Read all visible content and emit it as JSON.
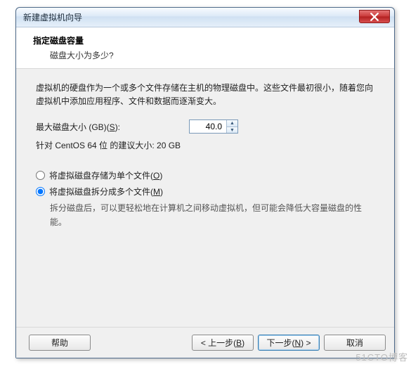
{
  "window": {
    "title": "新建虚拟机向导"
  },
  "header": {
    "title": "指定磁盘容量",
    "subtitle": "磁盘大小为多少?"
  },
  "content": {
    "description": "虚拟机的硬盘作为一个或多个文件存储在主机的物理磁盘中。这些文件最初很小，随着您向虚拟机中添加应用程序、文件和数据而逐渐变大。",
    "max_size_label_pre": "最大磁盘大小 (GB)(",
    "max_size_mnemonic": "S",
    "max_size_label_post": "):",
    "max_size_value": "40.0",
    "recommended": "针对 CentOS 64 位 的建议大小: 20 GB",
    "radio_single_pre": "将虚拟磁盘存储为单个文件(",
    "radio_single_mnemonic": "O",
    "radio_single_post": ")",
    "radio_split_pre": "将虚拟磁盘拆分成多个文件(",
    "radio_split_mnemonic": "M",
    "radio_split_post": ")",
    "radio_split_desc": "拆分磁盘后，可以更轻松地在计算机之间移动虚拟机，但可能会降低大容量磁盘的性能。"
  },
  "footer": {
    "help": "帮助",
    "back_pre": "< 上一步(",
    "back_mnemonic": "B",
    "back_post": ")",
    "next_pre": "下一步(",
    "next_mnemonic": "N",
    "next_post": ") >",
    "cancel": "取消"
  },
  "watermark": "51CTO博客"
}
